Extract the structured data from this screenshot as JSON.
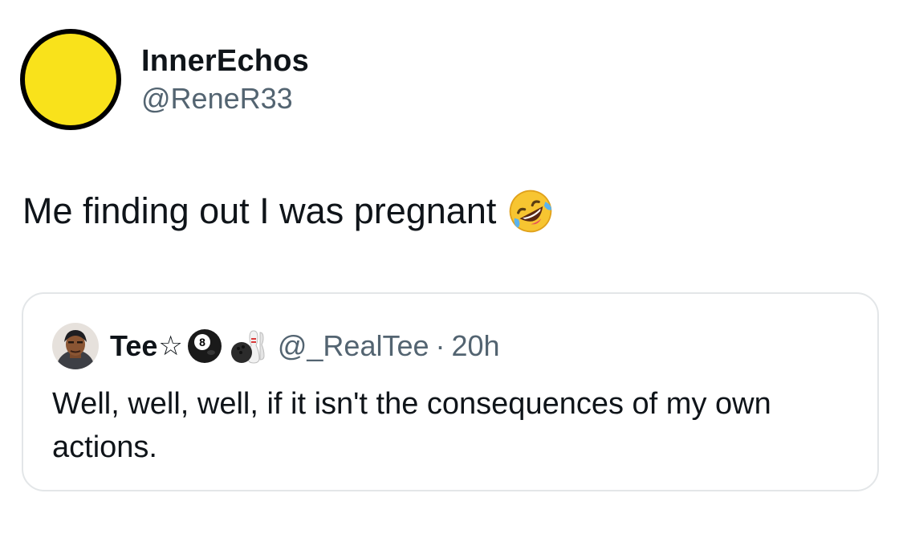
{
  "tweet": {
    "author": {
      "display_name": "InnerEchos",
      "handle": "@ReneR33",
      "avatar_color": "#f9e21b",
      "avatar_icon": "yellow-circle-avatar"
    },
    "text": "Me finding out I was pregnant",
    "emoji": "rolling-on-the-floor-laughing-emoji"
  },
  "quote": {
    "author": {
      "display_name": "Tee",
      "name_symbol": "☆",
      "name_emojis": [
        "pool-8-ball-emoji",
        "bowling-emoji"
      ],
      "handle": "@_RealTee",
      "separator": "·",
      "time": "20h"
    },
    "text": "Well, well, well, if it isn't the consequences of my own actions."
  },
  "colors": {
    "text_primary": "#0f1419",
    "text_secondary": "#536471",
    "border": "#e3e6e8",
    "background": "#ffffff"
  }
}
